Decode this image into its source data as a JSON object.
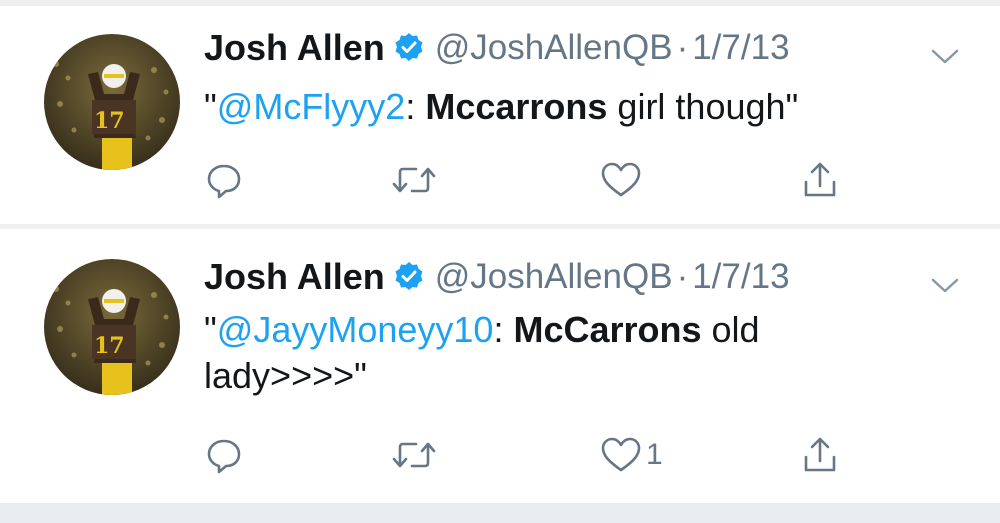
{
  "colors": {
    "accent": "#1da1f2",
    "text": "#14171a",
    "muted": "#657786",
    "divider": "#eef0f2"
  },
  "tweets": [
    {
      "author_name": "Josh Allen",
      "verified": true,
      "handle": "@JoshAllenQB",
      "separator": "·",
      "date": "1/7/13",
      "text_open": "\"",
      "mention": "@McFlyyy2",
      "text_colon": ": ",
      "text_bold": "Mccarrons",
      "text_rest": " girl though\"",
      "icons": [
        "avatar",
        "verified-badge-icon",
        "chevron-down-icon",
        "reply-icon",
        "retweet-icon",
        "heart-icon",
        "share-icon"
      ],
      "like_count": ""
    },
    {
      "author_name": "Josh Allen",
      "verified": true,
      "handle": "@JoshAllenQB",
      "separator": "·",
      "date": "1/7/13",
      "text_open": "\"",
      "mention": "@JayyMoneyy10",
      "text_colon": ": ",
      "text_bold": "McCarrons",
      "text_rest": " old lady>>>>\"",
      "icons": [
        "avatar",
        "verified-badge-icon",
        "chevron-down-icon",
        "reply-icon",
        "retweet-icon",
        "heart-icon",
        "share-icon"
      ],
      "like_count": "1"
    }
  ]
}
